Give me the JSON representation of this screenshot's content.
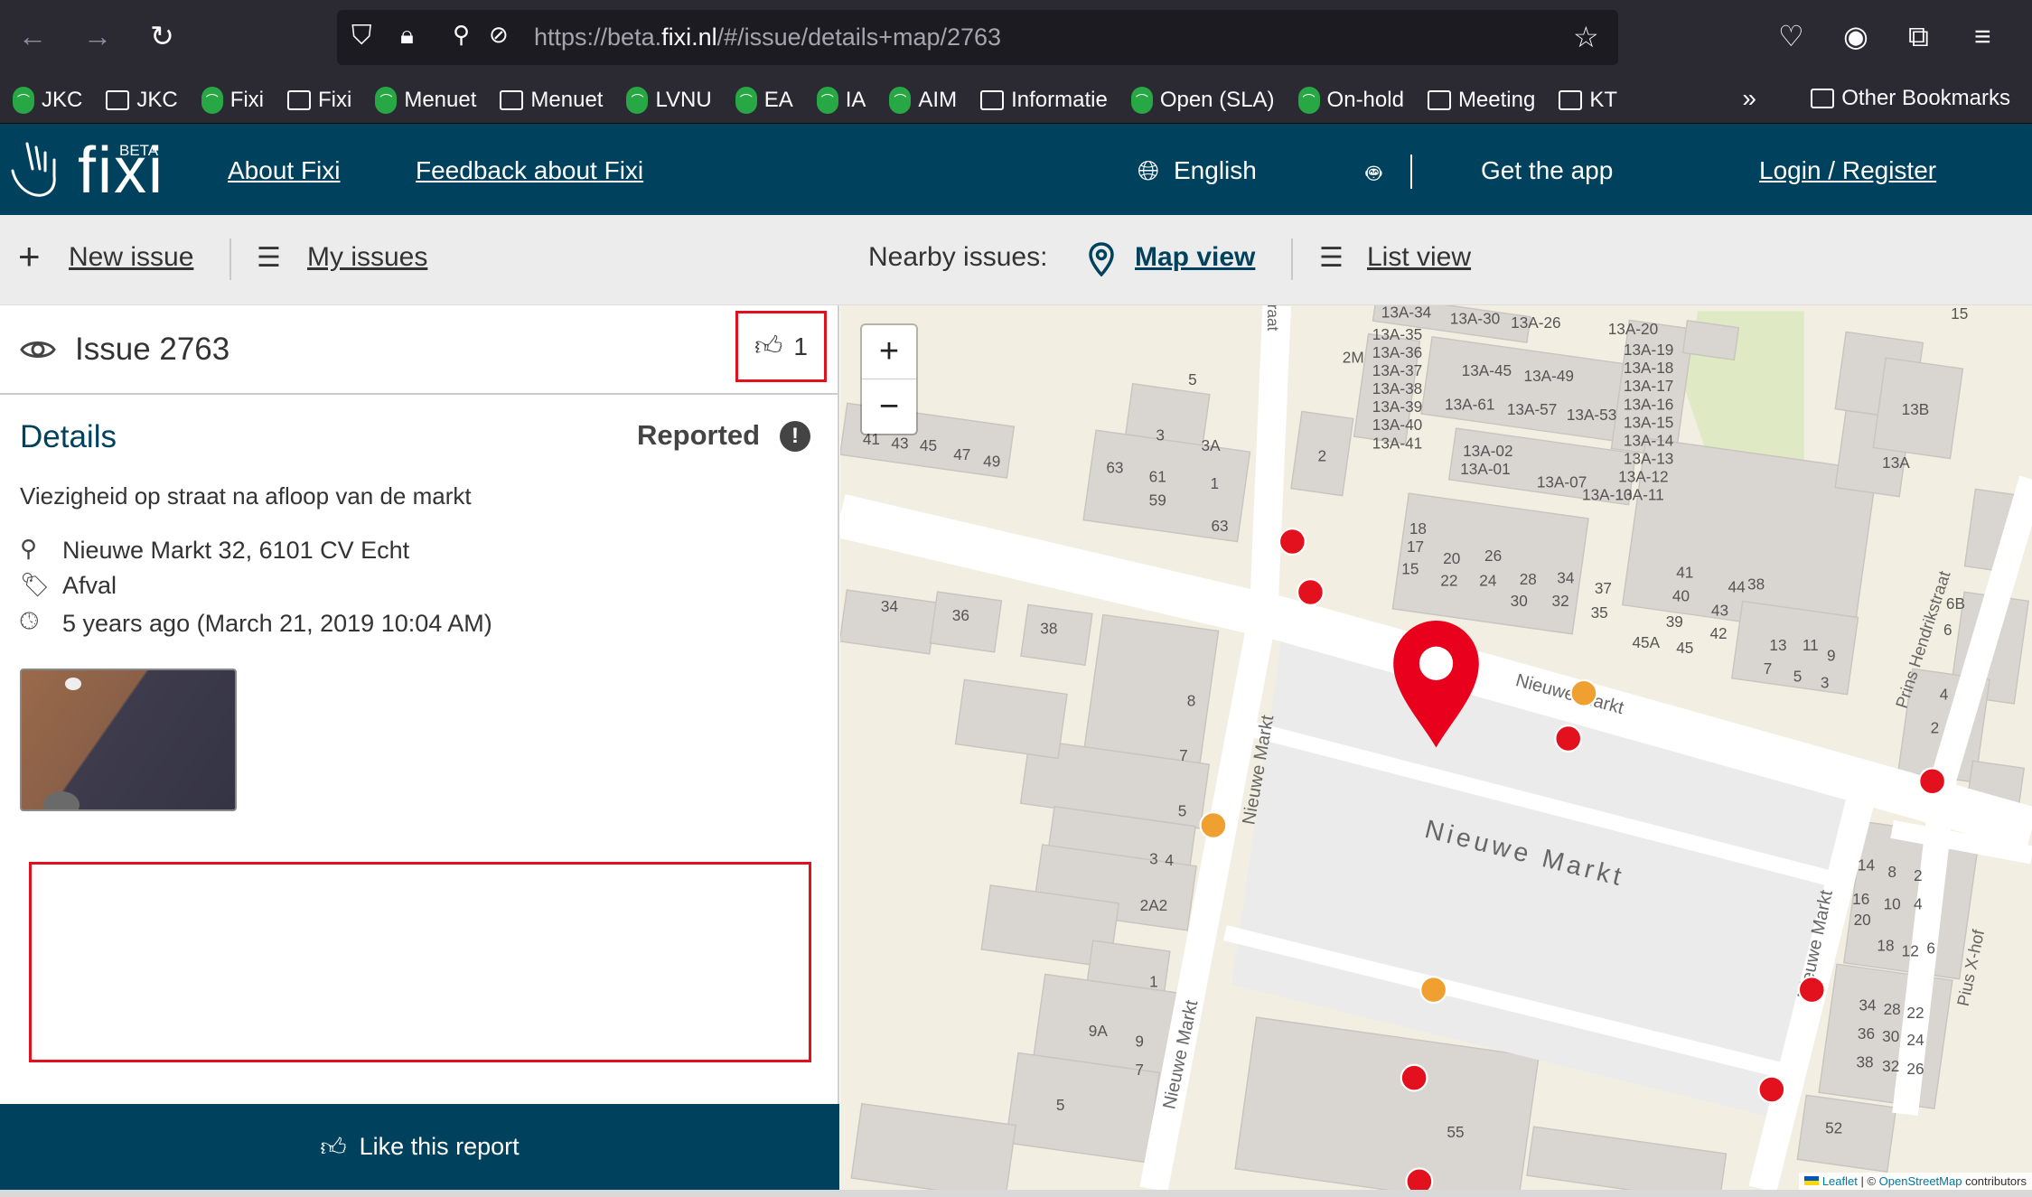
{
  "browser": {
    "url_prefix": "https://beta.",
    "url_domain": "fixi.nl",
    "url_suffix": "/#/issue/details+map/2763",
    "bookmarks": [
      {
        "label": "JKC",
        "icon": "green-app-icon"
      },
      {
        "label": "JKC",
        "icon": "folder-icon"
      },
      {
        "label": "Fixi",
        "icon": "green-app-icon"
      },
      {
        "label": "Fixi",
        "icon": "folder-icon"
      },
      {
        "label": "Menuet",
        "icon": "green-app-icon"
      },
      {
        "label": "Menuet",
        "icon": "folder-icon"
      },
      {
        "label": "LVNU",
        "icon": "green-app-icon"
      },
      {
        "label": "EA",
        "icon": "green-app-icon"
      },
      {
        "label": "IA",
        "icon": "green-app-icon"
      },
      {
        "label": "AIM",
        "icon": "green-app-icon"
      },
      {
        "label": "Informatie",
        "icon": "folder-icon"
      },
      {
        "label": "Open (SLA)",
        "icon": "green-app-icon"
      },
      {
        "label": "On-hold",
        "icon": "green-app-icon"
      },
      {
        "label": "Meeting",
        "icon": "folder-icon"
      },
      {
        "label": "KT",
        "icon": "folder-icon"
      }
    ],
    "other_bookmarks": "Other Bookmarks"
  },
  "header": {
    "logo_text": "fixi",
    "logo_badge": "BETA",
    "about": "About Fixi",
    "feedback": "Feedback about Fixi",
    "language": "English",
    "get_app": "Get the app",
    "login": "Login / Register",
    "brand_color": "#00425e"
  },
  "subnav": {
    "new_issue": "New issue",
    "my_issues": "My issues",
    "nearby": "Nearby issues:",
    "map_view": "Map view",
    "list_view": "List view"
  },
  "issue": {
    "title": "Issue 2763",
    "likes": "1",
    "details_heading": "Details",
    "status": "Reported",
    "description": "Viezigheid op straat na afloop van de markt",
    "address": "Nieuwe Markt 32, 6101 CV Echt",
    "category": "Afval",
    "time": "5 years ago (March 21, 2019 10:04 AM)",
    "like_button": "Like this report"
  },
  "map": {
    "zoom_in": "+",
    "zoom_out": "−",
    "attribution_leaflet": "Leaflet",
    "attribution_sep": " | © ",
    "attribution_osm": "OpenStreetMap",
    "attribution_tail": " contributors",
    "marker_colors": {
      "selected": "#e8001c",
      "open": "#e3101e",
      "in_progress": "#f0a030"
    },
    "street_labels": [
      "Nieuwe Markt",
      "Nieuwe Markt",
      "Nieuwe Markt",
      "Nieuwe Markt",
      "Nieuwe Markt",
      "Prins Hendrikstraat",
      "Pius X-hof",
      "raat"
    ],
    "house_numbers": [
      "13A-34",
      "13A-30",
      "13A-26",
      "13A-20",
      "13A-35",
      "13A-36",
      "13A-37",
      "13A-38",
      "13A-39",
      "13A-40",
      "13A-41",
      "2M",
      "13A-45",
      "13A-49",
      "13A-61",
      "13A-57",
      "13A-53",
      "13A-19",
      "13A-18",
      "13A-17",
      "13A-16",
      "13A-15",
      "13A-14",
      "13A-13",
      "13A-12",
      "13A-11",
      "13A-10",
      "13A-07",
      "13A-02",
      "13A-01",
      "15",
      "13B",
      "13A",
      "5",
      "3",
      "3A",
      "1",
      "63",
      "61",
      "59",
      "63",
      "41",
      "43",
      "45",
      "47",
      "49",
      "2",
      "18",
      "17",
      "15",
      "20",
      "22",
      "26",
      "24",
      "28",
      "30",
      "34",
      "32",
      "37",
      "35",
      "41",
      "40",
      "39",
      "45A",
      "45",
      "44",
      "38",
      "43",
      "42",
      "13",
      "11",
      "9",
      "7",
      "5",
      "3",
      "6B",
      "6",
      "4",
      "2",
      "34",
      "36",
      "38",
      "8",
      "7",
      "5",
      "4",
      "3",
      "2A2",
      "1",
      "9A",
      "9",
      "7",
      "5",
      "55",
      "14",
      "8",
      "2",
      "16",
      "10",
      "4",
      "20",
      "18",
      "12",
      "6",
      "34",
      "28",
      "22",
      "36",
      "30",
      "24",
      "38",
      "32",
      "26",
      "52"
    ]
  }
}
